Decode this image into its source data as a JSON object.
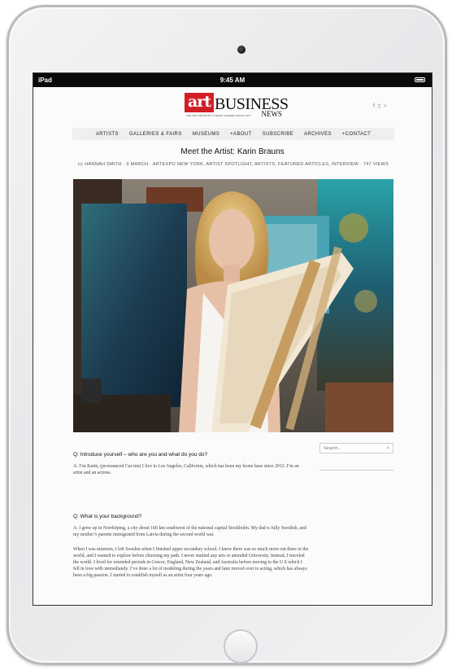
{
  "status_bar": {
    "carrier": "iPad",
    "time": "9:45 AM"
  },
  "site": {
    "logo_art": "art",
    "logo_business": "BUSINESS",
    "logo_news": "NEWS",
    "tagline": "THE ART INDUSTRY'S NEWS LEADER SINCE 1977",
    "social_icons": [
      "facebook-icon",
      "twitter-icon",
      "search-icon"
    ]
  },
  "nav": {
    "items": [
      "ARTISTS",
      "GALLERIES & FAIRS",
      "MUSEUMS",
      "+ABOUT",
      "SUBSCRIBE",
      "ARCHIVES",
      "+CONTACT"
    ]
  },
  "article": {
    "title": "Meet the Artist: Karin Brauns",
    "byline_by": "by",
    "byline_rest": "HANNAH SMITH  ·  9 MARCH  ·  ARTEXPO NEW YORK, ARTIST SPOTLIGHT, ARTISTS, FEATURED ARTICLES, INTERVIEW  ·  747 VIEWS",
    "q1": "Q: Introduce yourself – who are you and what do you do?",
    "a1": "A: I’m Karin, (pronounced Car-inn) I live in Los Angeles, California, which has been my home base since 2012. I’m an artist and an actress.",
    "q2": "Q: What is your background?",
    "a2": "A: I grew up in Norrköping, a city about 160 km southwest of the national capital Stockholm. My dad is fully Swedish, and my mother’s parents immigrated from Latvia during the second world war.",
    "a3": "When I was nineteen, I left Sweden when I finished upper secondary school. I knew there was so much more out there in the world, and I wanted to explore before choosing my path. I never studied any arts or attended University. Instead, I traveled the world. I lived for extended periods in Greece, England, New Zealand, and Australia before moving to the U.S which I fell in love with immediately. I’ve done a lot of modeling during the years and later moved over to acting, which has always been a big passion. I started to establish myself as an artist four years ago."
  },
  "sidebar": {
    "search_placeholder": "Search..."
  }
}
